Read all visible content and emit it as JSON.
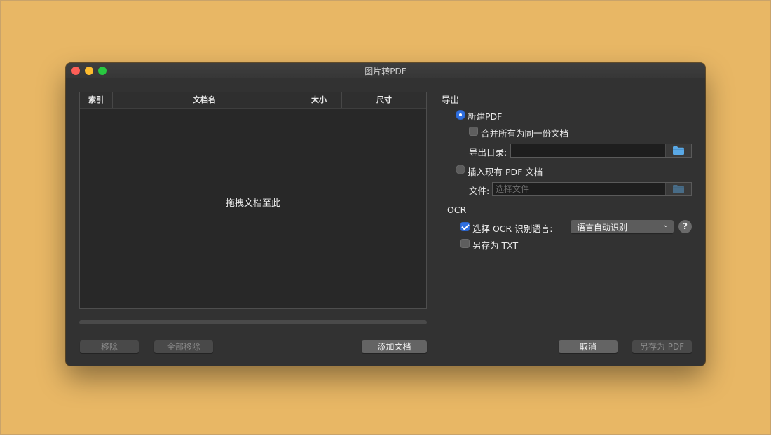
{
  "window": {
    "title": "图片转PDF"
  },
  "file_list": {
    "columns": [
      "索引",
      "文档名",
      "大小",
      "尺寸"
    ],
    "empty_hint": "拖拽文档至此",
    "progress": 0
  },
  "buttons": {
    "remove": "移除",
    "remove_all": "全部移除",
    "add": "添加文档",
    "cancel": "取消",
    "save_pdf": "另存为 PDF"
  },
  "export": {
    "section_label": "导出",
    "new_pdf_label": "新建PDF",
    "merge_label": "合并所有为同一份文档",
    "outdir_label": "导出目录:",
    "outdir_value": "",
    "insert_label": "插入现有 PDF 文档",
    "file_label": "文件:",
    "file_placeholder": "选择文件"
  },
  "ocr": {
    "section_label": "OCR",
    "select_lang_label": "选择 OCR 识别语言:",
    "lang_selected": "语言自动识别",
    "save_txt_label": "另存为 TXT",
    "help_glyph": "?"
  },
  "colors": {
    "accent": "#2f6fe0",
    "window_bg": "#323232",
    "desktop_bg": "#e8b765",
    "folder_icon": "#5aa9e6"
  },
  "icons": {
    "folder": "folder-icon",
    "chevron": "chevron-down-icon",
    "help": "help-icon"
  }
}
